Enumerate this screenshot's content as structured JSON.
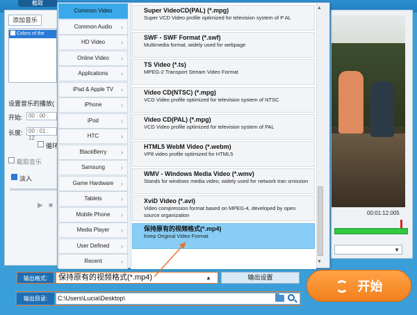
{
  "app": {
    "active_tab": "截取"
  },
  "left_panel": {
    "add_music": "添加音乐",
    "music_item": "Colors of the",
    "set_music_label": "设置音乐的播放(",
    "start_label": "开始:",
    "start_value": "00 : 00 :",
    "length_label": "长度:",
    "length_value": "00 : 01 : 12",
    "loop_label": "循环",
    "cut_music_label": "截取音乐",
    "fade_in_label": "淡入"
  },
  "preview": {
    "time_end": "00:01:12.005"
  },
  "categories": [
    {
      "label": "Common Video",
      "active": true
    },
    {
      "label": "Common Audio"
    },
    {
      "label": "HD Video"
    },
    {
      "label": "Online Video"
    },
    {
      "label": "Applications"
    },
    {
      "label": "iPad & Apple TV"
    },
    {
      "label": "iPhone"
    },
    {
      "label": "iPod"
    },
    {
      "label": "HTC"
    },
    {
      "label": "BlackBerry"
    },
    {
      "label": "Samsung"
    },
    {
      "label": "Game Hardware"
    },
    {
      "label": "Tablets"
    },
    {
      "label": "Mobile Phone"
    },
    {
      "label": "Media Player"
    },
    {
      "label": "User Defined"
    },
    {
      "label": "Recent"
    }
  ],
  "formats": [
    {
      "title": "Super VideoCD(PAL) (*.mpg)",
      "desc": "Super VCD Video profile optimized for television system of P AL"
    },
    {
      "title": "SWF - SWF Format (*.swf)",
      "desc": "Multimedia format, widely used for webpage"
    },
    {
      "title": "TS Video (*.ts)",
      "desc": "MPEG-2 Transport Stream Video Format"
    },
    {
      "title": "Video CD(NTSC) (*.mpg)",
      "desc": "VCD Video profile optimized for television system of NTSC"
    },
    {
      "title": "Video CD(PAL) (*.mpg)",
      "desc": "VCD Video profile optimized for television system of PAL"
    },
    {
      "title": "HTML5 WebM Video (*.webm)",
      "desc": "VP8 video profile optimized for HTML5"
    },
    {
      "title": "WMV - Windows Media Video (*.wmv)",
      "desc": "Stands for windows media video, widely used for network tran smission"
    },
    {
      "title": "XviD Video (*.avi)",
      "desc": "Video compression format based on MPEG-4, developed by open source organization"
    },
    {
      "title": "保持原有的视频格式(*.mp4)",
      "desc": "Keep Original Video Format",
      "selected": true
    }
  ],
  "bottom": {
    "output_format_label": "输出格式:",
    "output_format_value": "保持原有的视频格式(*.mp4)",
    "output_settings": "输出设置",
    "output_dir_label": "输出目录:",
    "output_dir_value": "C:\\Users\\Lucia\\Desktop\\",
    "start_button": "开始"
  },
  "colors": {
    "accent_blue": "#3aa9ea",
    "selected_format": "#87cdf5",
    "start_orange": "#f2801d",
    "highlight_orange": "#e8742c"
  }
}
